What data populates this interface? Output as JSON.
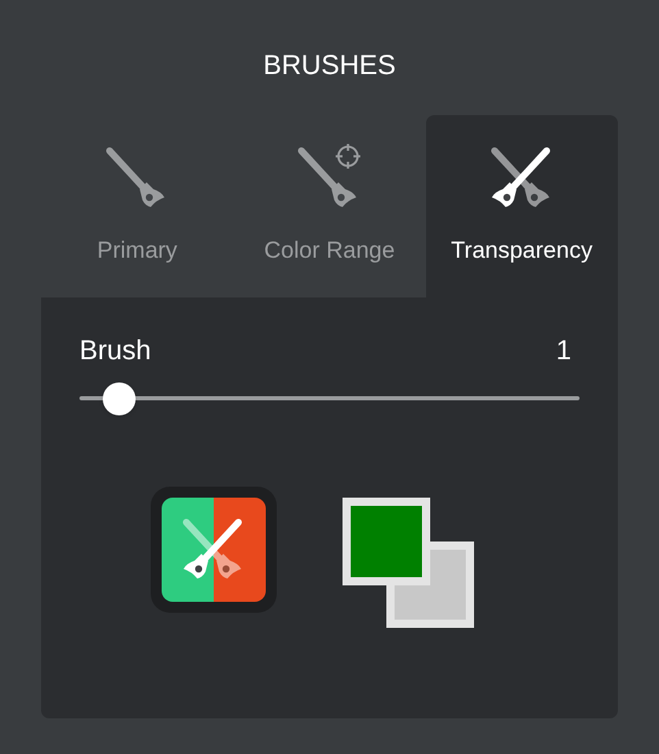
{
  "title": "BRUSHES",
  "tabs": [
    {
      "label": "Primary",
      "kind": "brush",
      "selected": false
    },
    {
      "label": "Color Range",
      "kind": "brush-target",
      "selected": false
    },
    {
      "label": "Transparency",
      "kind": "crossed-brushes",
      "selected": true
    }
  ],
  "brush": {
    "label": "Brush",
    "value": "1",
    "level": 0.05
  },
  "mode_button": {
    "halves": [
      {
        "color": "#2ecc80"
      },
      {
        "color": "#e8491d"
      }
    ]
  },
  "swatches": [
    {
      "kind": "foreground",
      "color": "#008000"
    },
    {
      "kind": "background",
      "color": "#c8c8c8"
    }
  ]
}
